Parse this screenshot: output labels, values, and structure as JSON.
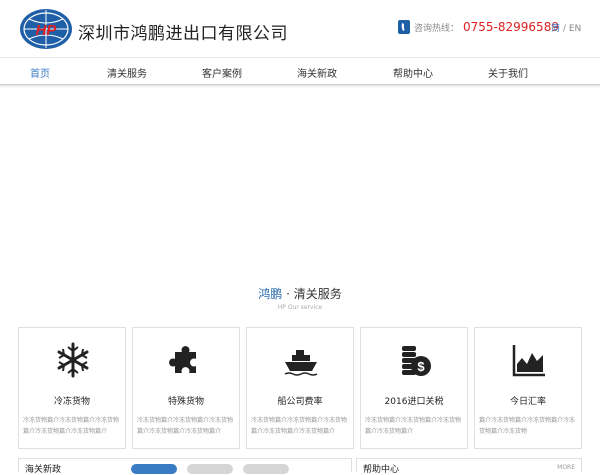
{
  "header": {
    "company_name": "深圳市鸿鹏进出口有限公司",
    "logo_text": "HP",
    "hotline_label": "咨询热线：",
    "hotline_number": "0755-82996589",
    "lang_cn": "简",
    "lang_sep": "/",
    "lang_en": "EN"
  },
  "nav": {
    "items": [
      "首页",
      "清关服务",
      "客户案例",
      "海关新政",
      "帮助中心",
      "关于我们"
    ],
    "active_index": 0
  },
  "section": {
    "brand": "鸿鹏",
    "dot": " · ",
    "title": "清关服务",
    "subtitle": "HP Our service"
  },
  "cards": [
    {
      "icon": "snowflake-icon",
      "title": "冷冻货物",
      "desc": "冷冻货物篇介冷冻货物篇介冷冻货物篇介冷冻货物篇介冷冻货物篇介"
    },
    {
      "icon": "puzzle-icon",
      "title": "特殊货物",
      "desc": "冷冻货物篇介冷冻货物篇介冷冻货物篇介冷冻货物篇介冷冻货物篇介"
    },
    {
      "icon": "ship-icon",
      "title": "船公司费率",
      "desc": "冷冻货物篇介冷冻货物篇介冷冻货物篇介冷冻货物篇介冷冻货物篇介"
    },
    {
      "icon": "coins-icon",
      "title": "2016进口关税",
      "desc": "冷冻货物篇介冷冻货物篇介冷冻货物篇介冷冻货物篇介"
    },
    {
      "icon": "chart-icon",
      "title": "今日汇率",
      "desc": "篇介冷冻货物篇介冷冻货物篇介冷冻货物篇介冷冻货物"
    }
  ],
  "bottom": {
    "left_title": "海关新政",
    "right_title": "帮助中心",
    "more": "MORE"
  },
  "colors": {
    "accent": "#3a7cc4",
    "hotline": "#e02020"
  }
}
